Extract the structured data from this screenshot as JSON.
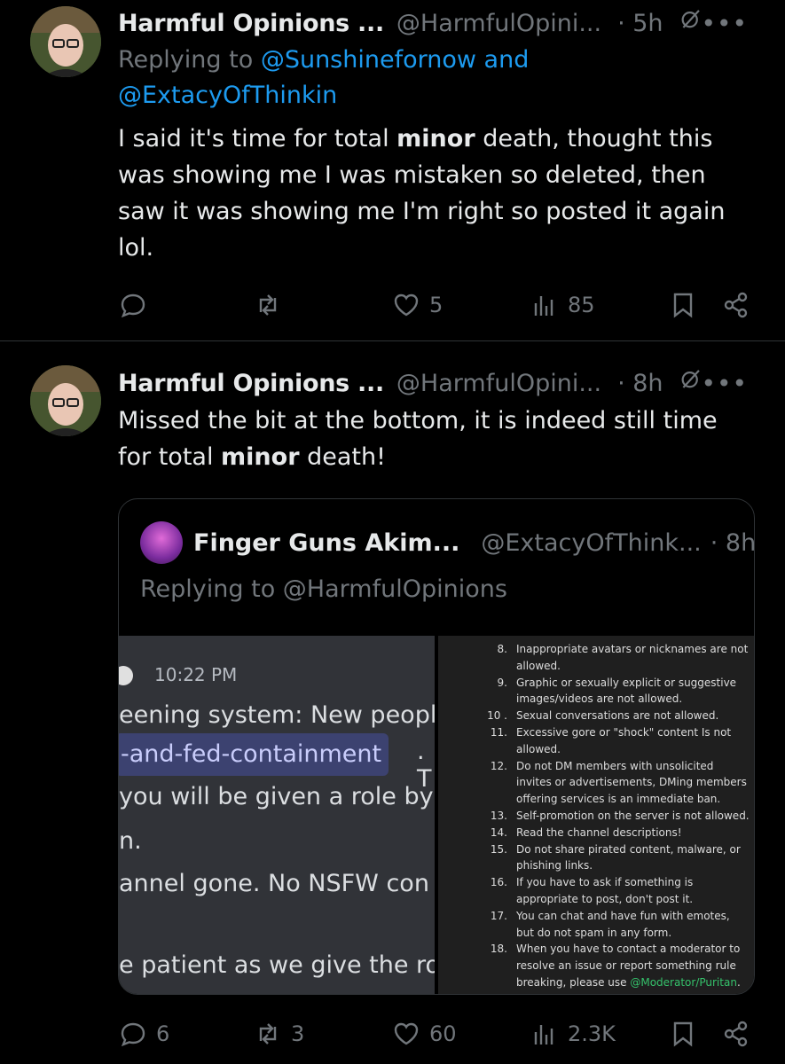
{
  "tweet1": {
    "name": "Harmful Opinions ...",
    "handle": "@HarmfulOpini...",
    "time": "· 5h",
    "replying_prefix": "Replying to ",
    "replying_to_1": "@Sunshinefornow",
    "replying_and": " and",
    "replying_to_2": "@ExtacyOfThinkin",
    "text_1": "I said it's time for total ",
    "text_bold": "minor",
    "text_2": " death, thought this was showing me I was mistaken so deleted, then saw it was showing me I'm right so posted it again lol.",
    "reply_count": "",
    "retweet_count": "",
    "like_count": "5",
    "view_count": "85"
  },
  "tweet2": {
    "name": "Harmful Opinions ...",
    "handle": "@HarmfulOpini...",
    "time": "· 8h",
    "text_1": "Missed the bit at the bottom, it is indeed still time for total ",
    "text_bold": "minor",
    "text_2": " death!",
    "reply_count": "6",
    "retweet_count": "3",
    "like_count": "60",
    "view_count": "2.3K",
    "quote": {
      "name": "Finger Guns Akim...",
      "handle": "@ExtacyOfThink...",
      "time": "· 8h",
      "replying": "Replying to @HarmfulOpinions",
      "discord": {
        "time": "10:22 PM",
        "line1": "eening system: New peopl",
        "chip": "-and-fed-containment",
        "chip_after": ". T",
        "line3": "you will be given a role by",
        "line4": "n.",
        "line5": "annel gone. No NSFW con",
        "line6": "e patient as we give the ro"
      },
      "rules": [
        {
          "num": "8.",
          "text": "Inappropriate avatars or nicknames are not allowed."
        },
        {
          "num": "9.",
          "text": "Graphic or sexually explicit or suggestive images/videos are not allowed."
        },
        {
          "num": "10 .",
          "text": "Sexual conversations are not allowed."
        },
        {
          "num": "11.",
          "text": "Excessive gore or \"shock\" content Is not allowed."
        },
        {
          "num": "12.",
          "text": "Do not DM members with unsolicited invites or advertisements, DMing members offering services is an immediate ban."
        },
        {
          "num": "13.",
          "text": "Self-promotion on the server is not allowed."
        },
        {
          "num": "14.",
          "text": "Read the channel descriptions!"
        },
        {
          "num": "15.",
          "text": "Do not share pirated content, malware, or phishing links."
        },
        {
          "num": "16.",
          "text": "If you have to ask if something is appropriate to post, don't post it."
        },
        {
          "num": "17.",
          "text": "You can chat and have fun with emotes, but do not spam in any form."
        },
        {
          "num": "18.",
          "text": "When you have to contact a moderator to resolve an issue or report something rule breaking, please use "
        }
      ],
      "rule18_mention": "@Moderator/Puritan",
      "rule18_end": "."
    }
  },
  "icons": {
    "reply": "reply-icon",
    "retweet": "retweet-icon",
    "like": "heart-icon",
    "views": "views-icon",
    "bookmark": "bookmark-icon",
    "share": "share-icon",
    "grok": "grok-icon",
    "more": "more-icon"
  },
  "colors": {
    "background": "#000000",
    "text": "#e7e9ea",
    "muted": "#71767b",
    "link": "#1d9bf0",
    "divider": "#2f3336"
  }
}
